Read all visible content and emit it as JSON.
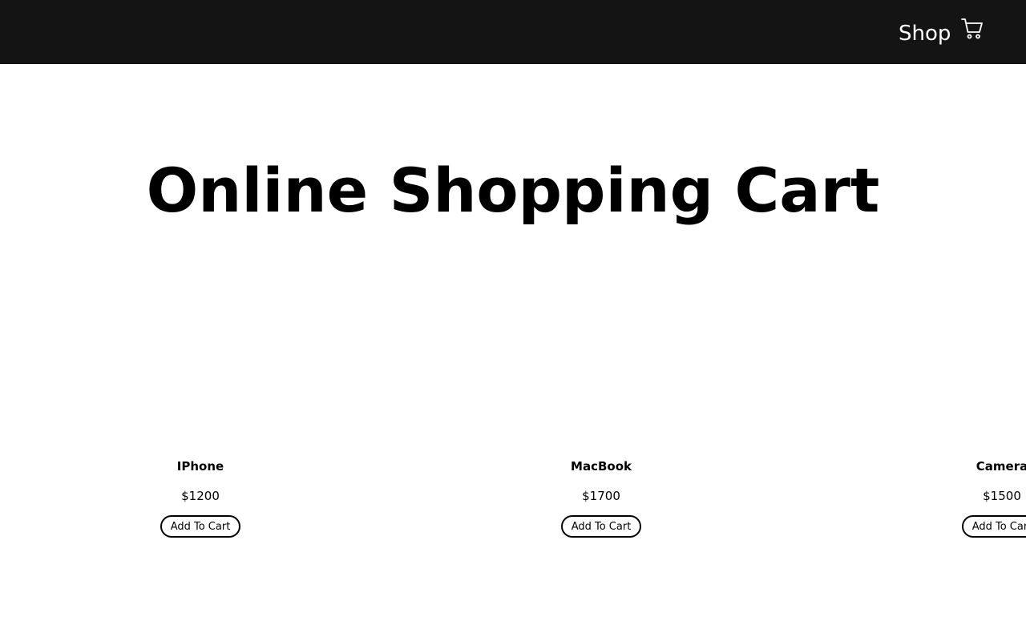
{
  "navbar": {
    "shop_label": "Shop",
    "cart_icon": "shopping-cart-icon",
    "background": "#141414",
    "text_color": "#ffffff"
  },
  "hero": {
    "title": "Online Shopping Cart"
  },
  "products": [
    {
      "name": "IPhone",
      "price": "$1200",
      "button_label": "Add To Cart"
    },
    {
      "name": "MacBook",
      "price": "$1700",
      "button_label": "Add To Cart"
    },
    {
      "name": "Camera",
      "price": "$1500",
      "button_label": "Add To Cart"
    }
  ]
}
